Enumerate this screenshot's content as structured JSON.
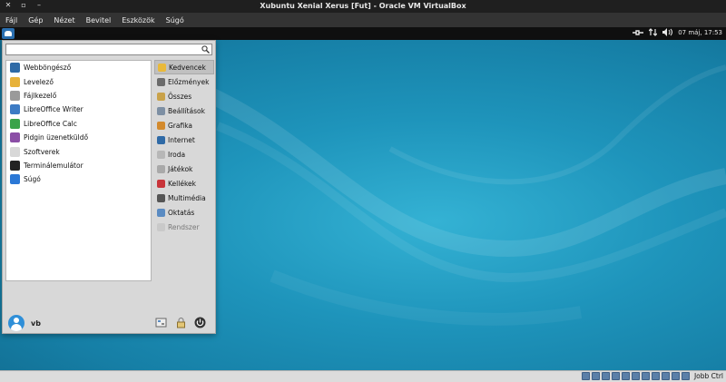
{
  "window": {
    "title": "Xubuntu Xenial Xerus [Fut] - Oracle VM VirtualBox"
  },
  "host_menu": [
    "Fájl",
    "Gép",
    "Nézet",
    "Bevitel",
    "Eszközök",
    "Súgó"
  ],
  "panel": {
    "clock": "07 máj, 17:53"
  },
  "menu": {
    "search": {
      "value": "",
      "placeholder": ""
    },
    "apps": [
      {
        "label": "Webböngésző",
        "icon": "web-browser-icon",
        "color": "#2f6aa6"
      },
      {
        "label": "Levelező",
        "icon": "mail-icon",
        "color": "#e7b23a"
      },
      {
        "label": "Fájlkezelő",
        "icon": "file-manager-icon",
        "color": "#9a9a9a"
      },
      {
        "label": "LibreOffice Writer",
        "icon": "writer-icon",
        "color": "#3c7bc4"
      },
      {
        "label": "LibreOffice Calc",
        "icon": "calc-icon",
        "color": "#3aa34a"
      },
      {
        "label": "Pidgin üzenetküldő",
        "icon": "pidgin-icon",
        "color": "#8b4ea6"
      },
      {
        "label": "Szoftverek",
        "icon": "software-icon",
        "color": "#d8d8d8"
      },
      {
        "label": "Terminálemulátor",
        "icon": "terminal-icon",
        "color": "#222222"
      },
      {
        "label": "Súgó",
        "icon": "help-icon",
        "color": "#2b78d6"
      }
    ],
    "categories": [
      {
        "label": "Kedvencek",
        "icon": "favorites-icon",
        "color": "#e9b93a",
        "active": true
      },
      {
        "label": "Előzmények",
        "icon": "history-icon",
        "color": "#6b6b6b"
      },
      {
        "label": "Összes",
        "icon": "folder-icon",
        "color": "#c9a24a"
      },
      {
        "label": "Beállítások",
        "icon": "settings-icon",
        "color": "#7d8fa3"
      },
      {
        "label": "Grafika",
        "icon": "graphics-icon",
        "color": "#d38a2d"
      },
      {
        "label": "Internet",
        "icon": "internet-icon",
        "color": "#2f6aa6"
      },
      {
        "label": "Iroda",
        "icon": "office-icon",
        "color": "#b7b7b7"
      },
      {
        "label": "Játékok",
        "icon": "games-icon",
        "color": "#a9a9a9"
      },
      {
        "label": "Kellékek",
        "icon": "accessories-icon",
        "color": "#c8343a"
      },
      {
        "label": "Multimédia",
        "icon": "multimedia-icon",
        "color": "#555555"
      },
      {
        "label": "Oktatás",
        "icon": "education-icon",
        "color": "#5a8bc2"
      },
      {
        "label": "Rendszer",
        "icon": "system-icon",
        "color": "#c9c9c9",
        "disabled": true
      }
    ],
    "user": "vb"
  },
  "statusbar": {
    "host_key": "Jobb Ctrl"
  },
  "colors": {
    "desktop": "#1e94bb",
    "selection": "#c0c0c0",
    "panel": "#0f0f0f"
  }
}
